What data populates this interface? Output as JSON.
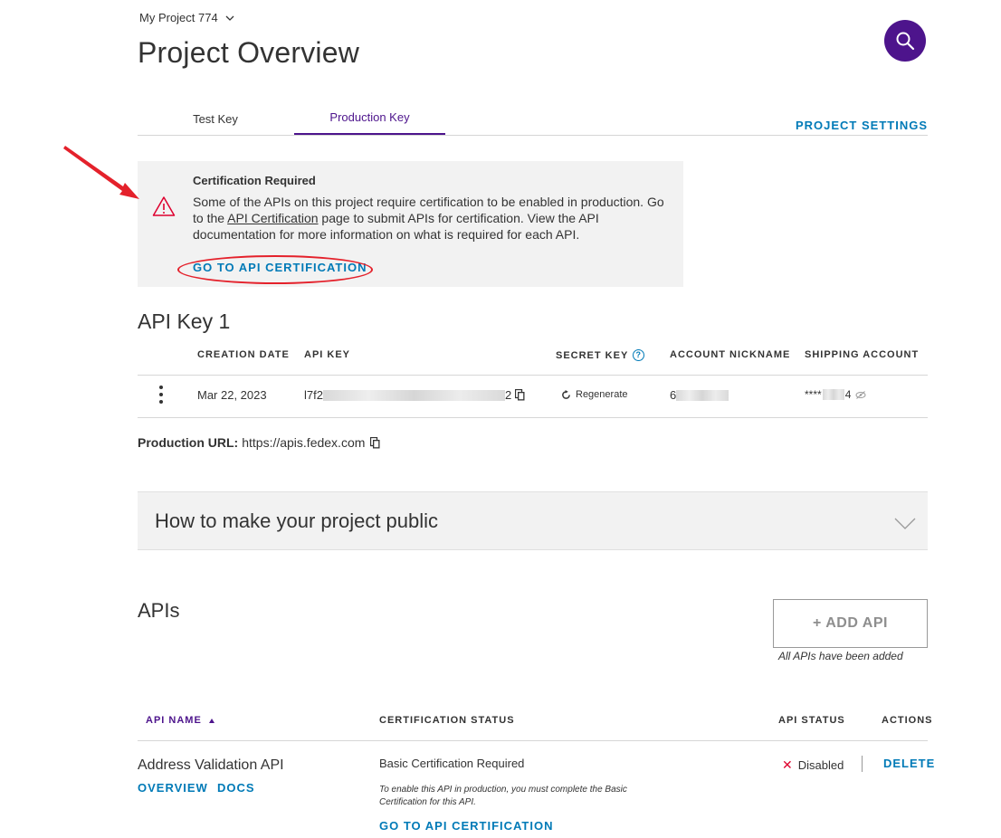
{
  "header": {
    "project_name": "My Project 774",
    "page_title": "Project Overview",
    "search_icon": "search-icon"
  },
  "tabs": [
    {
      "label": "Test Key",
      "active": false
    },
    {
      "label": "Production Key",
      "active": true
    }
  ],
  "project_settings_label": "PROJECT SETTINGS",
  "certification_banner": {
    "title": "Certification Required",
    "text_before_link": "Some of the APIs on this project require certification to be enabled in production. Go to the ",
    "link_text": "API Certification",
    "text_after_link": " page to submit APIs for certification. View the API documentation for more information on what is required for each API.",
    "cta": "GO TO API CERTIFICATION",
    "icon": "warning-icon"
  },
  "api_key_section": {
    "title": "API Key 1",
    "columns": [
      "CREATION DATE",
      "API KEY",
      "SECRET KEY",
      "ACCOUNT NICKNAME",
      "SHIPPING ACCOUNT"
    ],
    "row": {
      "creation_date": "Mar 22, 2023",
      "api_key_prefix": "l7f2",
      "api_key_suffix": "2",
      "regenerate_label": "Regenerate",
      "nickname_prefix": "6",
      "shipping_prefix": "****",
      "shipping_suffix": "4"
    },
    "help_glyph": "?"
  },
  "production_url": {
    "label": "Production URL:",
    "value": "https://apis.fedex.com"
  },
  "accordion": {
    "title": "How to make your project public"
  },
  "apis_section": {
    "title": "APIs",
    "add_button": "+ ADD API",
    "add_note": "All APIs have been added",
    "columns": {
      "name": "API NAME",
      "cert": "CERTIFICATION STATUS",
      "status": "API STATUS",
      "actions": "ACTIONS"
    },
    "rows": [
      {
        "name": "Address Validation API",
        "overview": "OVERVIEW",
        "docs": "DOCS",
        "cert_status": "Basic Certification Required",
        "cert_note": "To enable this API in production, you must complete the Basic Certification for this API.",
        "cert_cta": "GO TO API CERTIFICATION",
        "status": "Disabled",
        "delete": "DELETE"
      }
    ]
  },
  "colors": {
    "brand_purple": "#4d148c",
    "link_blue": "#007ab7",
    "annotation_red": "#e4212b",
    "disabled_red": "#de002e"
  }
}
